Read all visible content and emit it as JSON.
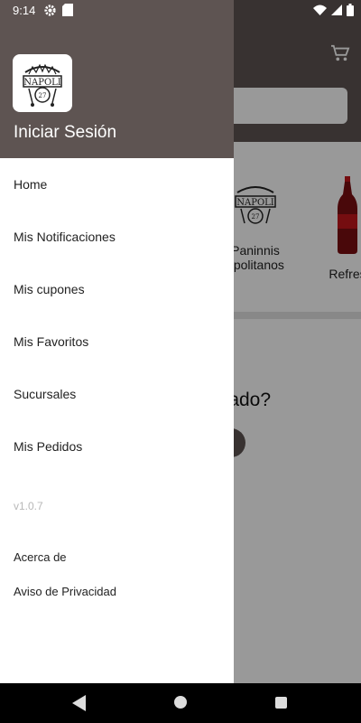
{
  "status_bar": {
    "time": "9:14",
    "icons": [
      "gear-icon",
      "sd-card-icon",
      "wifi-icon",
      "signal-icon",
      "battery-icon"
    ]
  },
  "background": {
    "toolbar_color": "#5e5452",
    "categories": [
      {
        "label": "Paninnis\napolitanos"
      },
      {
        "label": "Refres"
      }
    ],
    "question_text": "strado?"
  },
  "drawer": {
    "header_color": "#5e5452",
    "logo_text": "NAPOLI",
    "login_label": "Iniciar Sesión",
    "menu": [
      {
        "label": "Home"
      },
      {
        "label": "Mis Notificaciones"
      },
      {
        "label": "Mis cupones"
      },
      {
        "label": "Mis Favoritos"
      },
      {
        "label": "Sucursales"
      },
      {
        "label": "Mis Pedidos"
      }
    ],
    "version": "v1.0.7",
    "about_label": "Acerca de",
    "privacy_label": "Aviso de Privacidad"
  },
  "nav_bar": {
    "icons": [
      "back-icon",
      "home-icon",
      "recents-icon"
    ]
  }
}
